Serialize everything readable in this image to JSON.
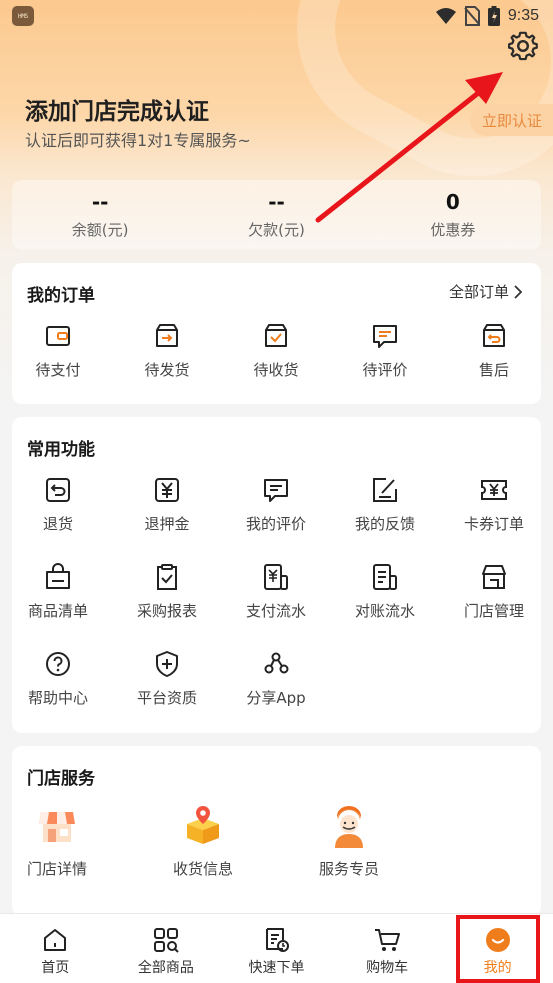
{
  "status_bar": {
    "app_badge": "HMS",
    "time": "9:35"
  },
  "header": {
    "title": "添加门店完成认证",
    "subtitle": "认证后即可获得1对1专属服务~",
    "verify_button": "立即认证",
    "settings_icon": "gear-icon"
  },
  "balance": [
    {
      "value": "--",
      "label": "余额(元)"
    },
    {
      "value": "--",
      "label": "欠款(元)"
    },
    {
      "value": "0",
      "label": "优惠券"
    }
  ],
  "orders": {
    "title": "我的订单",
    "all_label": "全部订单",
    "items": [
      {
        "label": "待支付",
        "icon": "wallet-icon"
      },
      {
        "label": "待发货",
        "icon": "box-arrow-icon"
      },
      {
        "label": "待收货",
        "icon": "box-check-icon"
      },
      {
        "label": "待评价",
        "icon": "comment-icon"
      },
      {
        "label": "售后",
        "icon": "return-box-icon"
      }
    ]
  },
  "functions": {
    "title": "常用功能",
    "items": [
      {
        "label": "退货",
        "icon": "return-icon"
      },
      {
        "label": "退押金",
        "icon": "yen-icon"
      },
      {
        "label": "我的评价",
        "icon": "comment-icon"
      },
      {
        "label": "我的反馈",
        "icon": "edit-icon"
      },
      {
        "label": "卡券订单",
        "icon": "coupon-icon"
      },
      {
        "label": "商品清单",
        "icon": "bag-icon"
      },
      {
        "label": "采购报表",
        "icon": "clipboard-icon"
      },
      {
        "label": "支付流水",
        "icon": "payment-flow-icon"
      },
      {
        "label": "对账流水",
        "icon": "statement-icon"
      },
      {
        "label": "门店管理",
        "icon": "store-icon"
      },
      {
        "label": "帮助中心",
        "icon": "help-icon"
      },
      {
        "label": "平台资质",
        "icon": "shield-plus-icon"
      },
      {
        "label": "分享App",
        "icon": "share-icon"
      }
    ]
  },
  "store_services": {
    "title": "门店服务",
    "items": [
      {
        "label": "门店详情",
        "icon": "shop-icon"
      },
      {
        "label": "收货信息",
        "icon": "package-location-icon"
      },
      {
        "label": "服务专员",
        "icon": "courier-icon"
      }
    ]
  },
  "tabbar": [
    {
      "label": "首页",
      "icon": "home-icon"
    },
    {
      "label": "全部商品",
      "icon": "grid-search-icon"
    },
    {
      "label": "快速下单",
      "icon": "quick-order-icon"
    },
    {
      "label": "购物车",
      "icon": "cart-icon"
    },
    {
      "label": "我的",
      "icon": "profile-smile-icon",
      "active": true
    }
  ],
  "colors": {
    "accent": "#f07d1b",
    "annotation_red": "#e8161b",
    "hero_top": "#fcc98f"
  }
}
